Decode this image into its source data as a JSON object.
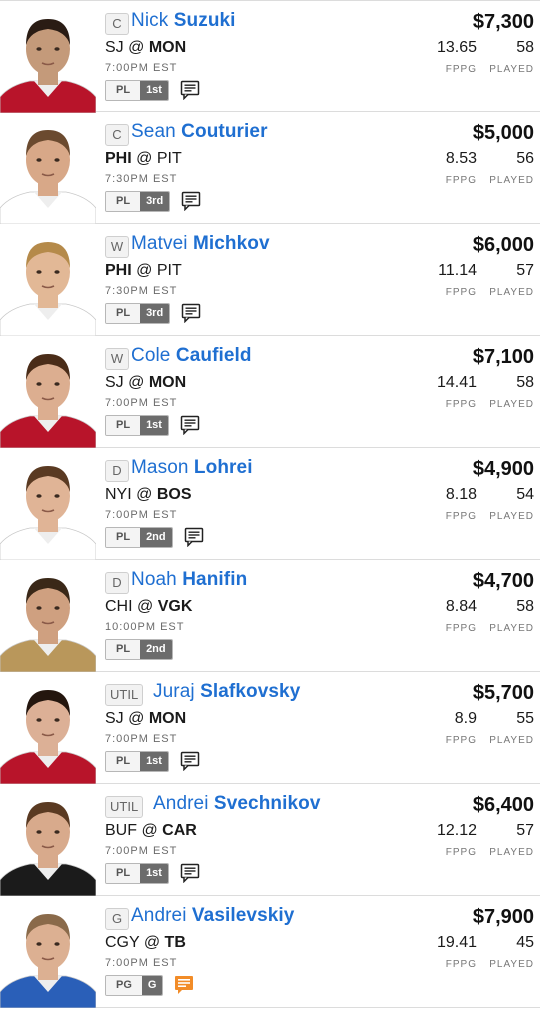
{
  "players": [
    {
      "position": "C",
      "first_name": "Nick",
      "last_name": "Suzuki",
      "away": "SJ",
      "home": "MON",
      "bold": "home",
      "time": "7:00PM EST",
      "salary": "$7,300",
      "fppg": "13.65",
      "played": "58",
      "badge_left": "PL",
      "badge_right": "1st",
      "jersey": "#b8142a",
      "hair": "#2a1c14",
      "skin": "#c49a7a",
      "note": "default"
    },
    {
      "position": "C",
      "first_name": "Sean",
      "last_name": "Couturier",
      "away": "PHI",
      "home": "PIT",
      "bold": "away",
      "time": "7:30PM EST",
      "salary": "$5,000",
      "fppg": "8.53",
      "played": "56",
      "badge_left": "PL",
      "badge_right": "3rd",
      "jersey": "#ffffff",
      "hair": "#6b4a2f",
      "skin": "#d8a888",
      "note": "default"
    },
    {
      "position": "W",
      "first_name": "Matvei",
      "last_name": "Michkov",
      "away": "PHI",
      "home": "PIT",
      "bold": "away",
      "time": "7:30PM EST",
      "salary": "$6,000",
      "fppg": "11.14",
      "played": "57",
      "badge_left": "PL",
      "badge_right": "3rd",
      "jersey": "#ffffff",
      "hair": "#b58a4a",
      "skin": "#e2b896",
      "note": "default"
    },
    {
      "position": "W",
      "first_name": "Cole",
      "last_name": "Caufield",
      "away": "SJ",
      "home": "MON",
      "bold": "home",
      "time": "7:00PM EST",
      "salary": "$7,100",
      "fppg": "14.41",
      "played": "58",
      "badge_left": "PL",
      "badge_right": "1st",
      "jersey": "#b8142a",
      "hair": "#4a2c18",
      "skin": "#dcae90",
      "note": "default"
    },
    {
      "position": "D",
      "first_name": "Mason",
      "last_name": "Lohrei",
      "away": "NYI",
      "home": "BOS",
      "bold": "home",
      "time": "7:00PM EST",
      "salary": "$4,900",
      "fppg": "8.18",
      "played": "54",
      "badge_left": "PL",
      "badge_right": "2nd",
      "jersey": "#ffffff",
      "hair": "#5a3a22",
      "skin": "#e0b496",
      "note": "default"
    },
    {
      "position": "D",
      "first_name": "Noah",
      "last_name": "Hanifin",
      "away": "CHI",
      "home": "VGK",
      "bold": "home",
      "time": "10:00PM EST",
      "salary": "$4,700",
      "fppg": "8.84",
      "played": "58",
      "badge_left": "PL",
      "badge_right": "2nd",
      "jersey": "#b9975b",
      "hair": "#3a2818",
      "skin": "#cfa080",
      "note": "none"
    },
    {
      "position": "UTIL",
      "first_name": "Juraj",
      "last_name": "Slafkovsky",
      "away": "SJ",
      "home": "MON",
      "bold": "home",
      "time": "7:00PM EST",
      "salary": "$5,700",
      "fppg": "8.9",
      "played": "55",
      "badge_left": "PL",
      "badge_right": "1st",
      "jersey": "#b8142a",
      "hair": "#24160e",
      "skin": "#dcb096",
      "note": "default"
    },
    {
      "position": "UTIL",
      "first_name": "Andrei",
      "last_name": "Svechnikov",
      "away": "BUF",
      "home": "CAR",
      "bold": "home",
      "time": "7:00PM EST",
      "salary": "$6,400",
      "fppg": "12.12",
      "played": "57",
      "badge_left": "PL",
      "badge_right": "1st",
      "jersey": "#1b1b1b",
      "hair": "#5a3a22",
      "skin": "#d8aa8c",
      "note": "default"
    },
    {
      "position": "G",
      "first_name": "Andrei",
      "last_name": "Vasilevskiy",
      "away": "CGY",
      "home": "TB",
      "bold": "home",
      "time": "7:00PM EST",
      "salary": "$7,900",
      "fppg": "19.41",
      "played": "45",
      "badge_left": "PG",
      "badge_right": "G",
      "jersey": "#2a5fb8",
      "hair": "#8a6a4a",
      "skin": "#dcb092",
      "note": "orange"
    }
  ],
  "labels": {
    "fppg": "FPPG",
    "played": "PLAYED",
    "at": "@"
  },
  "colors": {
    "name_link": "#1f6fd1",
    "note_default": "#222222",
    "note_orange": "#f28c28"
  }
}
